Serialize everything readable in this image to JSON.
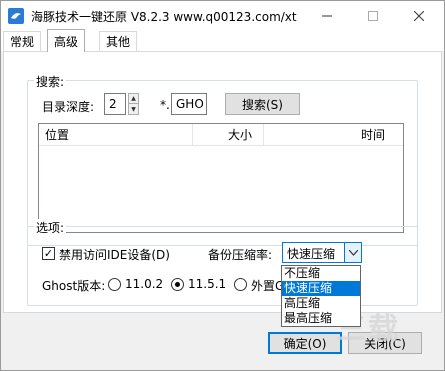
{
  "window": {
    "title": "海豚技术一键还原 V8.2.3 www.q00123.com/xt"
  },
  "tabs": [
    {
      "label": "常规"
    },
    {
      "label": "高级"
    },
    {
      "label": "其他"
    }
  ],
  "active_tab": "高级",
  "search_group": {
    "legend": "搜索:",
    "depth_label": "目录深度:",
    "depth_value": "2",
    "ext_prefix": "*.",
    "ext_value": "GHO",
    "search_button": "搜索(S)",
    "columns": [
      "位置",
      "大小",
      "时间"
    ]
  },
  "options_group": {
    "legend": "选项:",
    "disable_ide_label": "禁用访问IDE设备(D)",
    "disable_ide_checked": true,
    "compression_label": "备份压缩率:",
    "compression_value": "快速压缩",
    "compression_options": [
      "不压缩",
      "快速压缩",
      "高压缩",
      "最高压缩"
    ],
    "compression_selected_index": 1,
    "ghost_version_label": "Ghost版本:",
    "ghost_versions": [
      {
        "label": "11.0.2",
        "selected": false
      },
      {
        "label": "11.5.1",
        "selected": true
      },
      {
        "label": "外置G",
        "selected": false
      }
    ]
  },
  "footer": {
    "ok_button": "确定(O)",
    "close_button": "关闭(C)"
  },
  "watermark": "三载"
}
